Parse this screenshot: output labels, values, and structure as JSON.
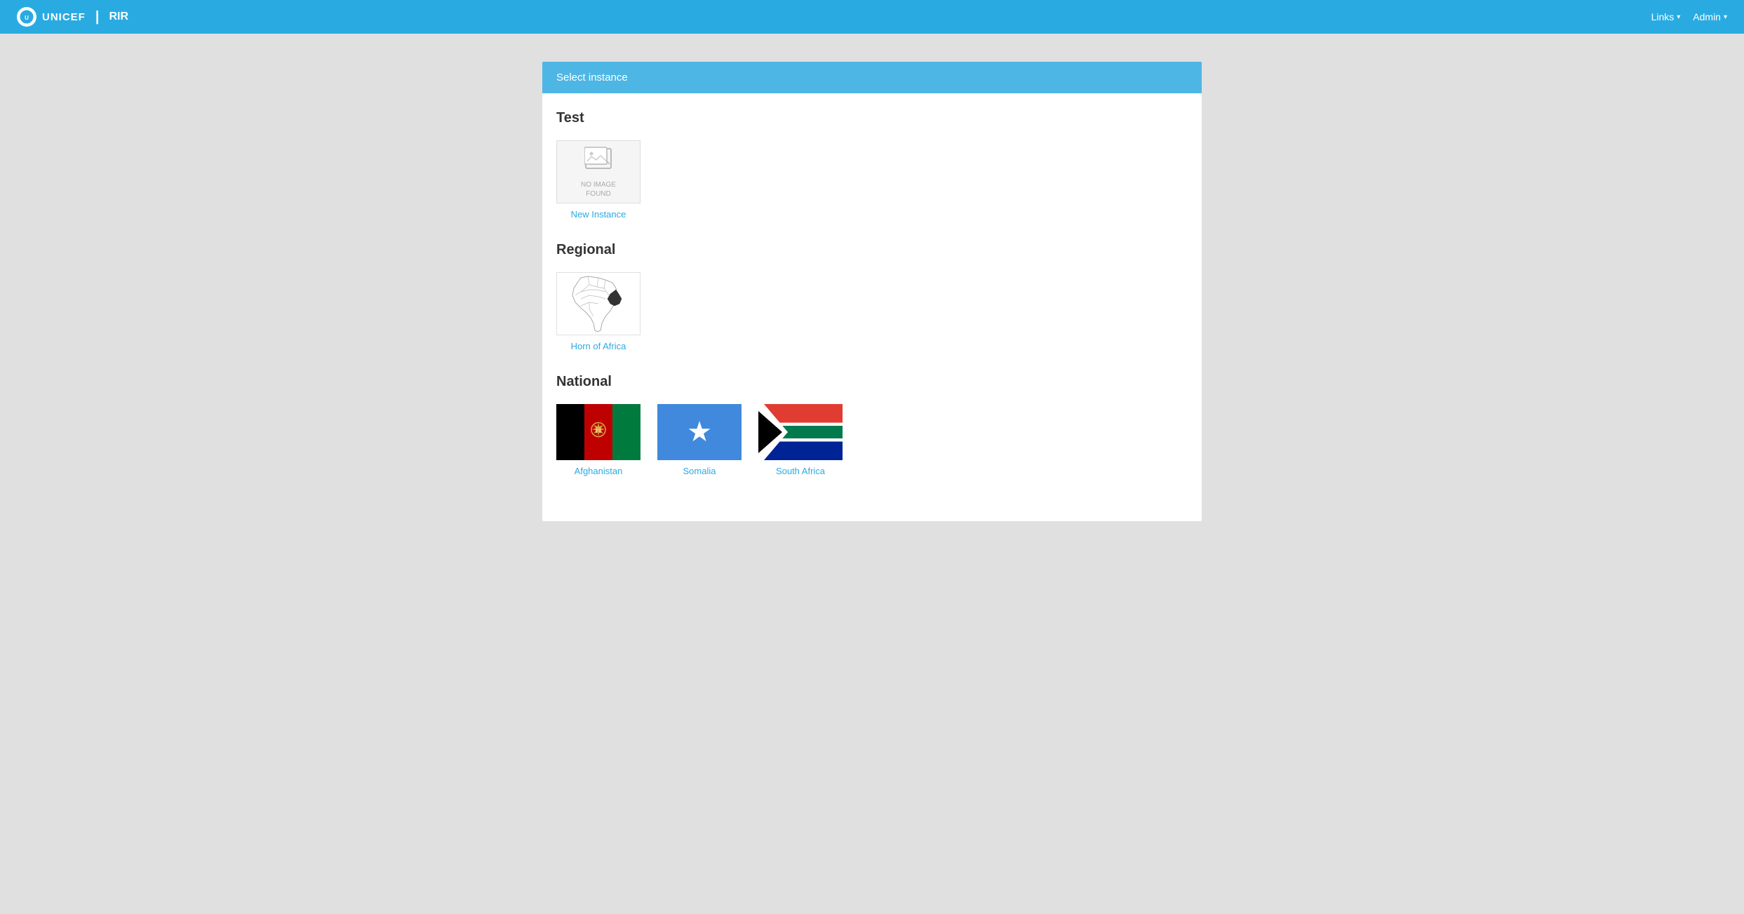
{
  "navbar": {
    "brand_logo_text": "unicef",
    "brand_separator": "|",
    "brand_app": "RIR",
    "links_label": "Links",
    "admin_label": "Admin"
  },
  "page": {
    "header": "Select instance",
    "sections": [
      {
        "id": "test",
        "title": "Test",
        "items": [
          {
            "id": "new-instance",
            "label": "New Instance",
            "type": "no-image"
          }
        ]
      },
      {
        "id": "regional",
        "title": "Regional",
        "items": [
          {
            "id": "horn-of-africa",
            "label": "Horn of Africa",
            "type": "map"
          }
        ]
      },
      {
        "id": "national",
        "title": "National",
        "items": [
          {
            "id": "afghanistan",
            "label": "Afghanistan",
            "type": "flag-afghanistan"
          },
          {
            "id": "somalia",
            "label": "Somalia",
            "type": "flag-somalia"
          },
          {
            "id": "south-africa",
            "label": "South Africa",
            "type": "flag-south-africa"
          }
        ]
      }
    ]
  }
}
